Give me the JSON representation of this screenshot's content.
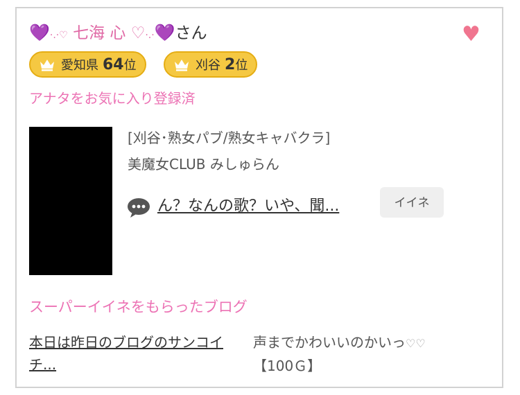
{
  "profile": {
    "name_prefix": "💜",
    "name_deco_left": "·.·♡",
    "name_text": " 七海 心 ♡",
    "name_deco_right": "·.·",
    "name_suffix_emoji": "💜",
    "name_suffix": "さん"
  },
  "favorite_icon": "heart-icon",
  "badges": [
    {
      "prefecture": "愛知県",
      "rank": "64",
      "unit": "位"
    },
    {
      "prefecture": "刈谷",
      "rank": "2",
      "unit": "位"
    }
  ],
  "favorite_status": "アナタをお気に入り登録済",
  "shop": {
    "category": "[刈谷･熟女パブ/熟女キャバクラ]",
    "name": "美魔女CLUB みしゅらん"
  },
  "comment": {
    "text": "ん？なんの歌？いや、聞...",
    "icon": "speech-bubble-icon"
  },
  "iine_button": "イイネ",
  "super_iine": {
    "title": "スーパーイイネをもらったブログ",
    "blog_title": "本日は昨日のブログのサンコイチ...",
    "comment": "声までかわいいのかいっ",
    "comment_hearts": "♡♡",
    "points": "【100Ｇ】"
  },
  "colors": {
    "accent_pink": "#ec72b4",
    "heart": "#f0758f",
    "badge_gold": "#f5c842",
    "purple": "#9b30e8"
  }
}
